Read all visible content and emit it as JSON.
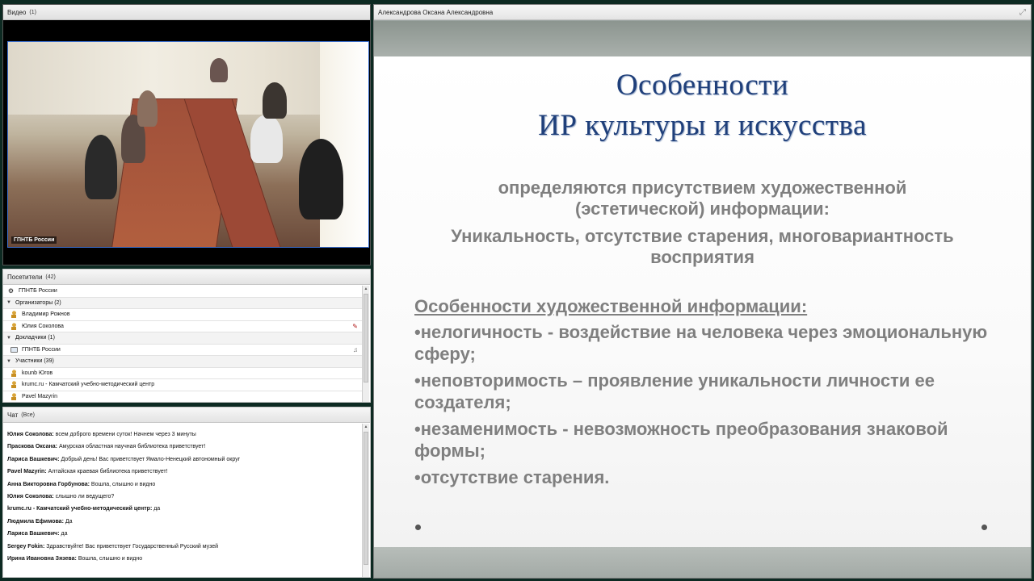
{
  "video_pod": {
    "title": "Видео",
    "count": "(1)",
    "camera_label": "ГПНТБ России"
  },
  "attendees_pod": {
    "title": "Посетители",
    "count": "(42)",
    "rows": [
      {
        "type": "room",
        "label": "ГПНТБ России"
      },
      {
        "type": "group",
        "label": "Организаторы (2)"
      },
      {
        "type": "member",
        "label": "Владимир Рожнов",
        "icon": "person-icon"
      },
      {
        "type": "member",
        "label": "Юлия Соколова",
        "icon": "person-icon",
        "status": "mic-off-icon"
      },
      {
        "type": "group",
        "label": "Докладчики (1)"
      },
      {
        "type": "member",
        "label": "ГПНТБ России",
        "icon": "monitor-icon",
        "status": "mic-on-icon"
      },
      {
        "type": "group",
        "label": "Участники (39)"
      },
      {
        "type": "member",
        "label": "kounb Югов",
        "icon": "person-icon"
      },
      {
        "type": "member",
        "label": "krumc.ru - Камчатский учебно-методический центр",
        "icon": "person-icon"
      },
      {
        "type": "member",
        "label": "Pavel Mazyrin",
        "icon": "person-icon"
      }
    ]
  },
  "chat_pod": {
    "title": "Чат",
    "scope": "(Все)",
    "messages": [
      {
        "author": "Юлия Соколова:",
        "text": " всем доброго времени суток! Начнем через 3 минуты"
      },
      {
        "author": "Праскова Оксана:",
        "text": " Амурская областная научная библиотека приветствует!"
      },
      {
        "author": "Лариса Вашкевич:",
        "text": " Добрый день! Вас приветствует Ямало-Ненецкий автономный округ"
      },
      {
        "author": "Pavel Mazyrin:",
        "text": " Алтайская краевая библиотека приветствует!"
      },
      {
        "author": "Анна Викторовна Горбунова:",
        "text": " Вошла, слышно и видно"
      },
      {
        "author": "Юлия Соколова:",
        "text": " слышно ли ведущего?"
      },
      {
        "author": "krumc.ru - Камчатский учебно-методический центр:",
        "text": " да"
      },
      {
        "author": "Людмила Ефимова:",
        "text": " Да"
      },
      {
        "author": "Лариса Вашкевич:",
        "text": " да"
      },
      {
        "author": "Sergey Fokin:",
        "text": " Здравствуйте! Вас приветствует Государственный Русский музей"
      },
      {
        "author": "Ирина Ивановна Зязева:",
        "text": " Вошла, слышно и видно"
      }
    ]
  },
  "share_pod": {
    "title": "Александрова Оксана Александровна",
    "slide": {
      "title_line1": "Особенности",
      "title_line2": "ИР культуры и искусства",
      "sub_line1": "определяются присутствием художественной",
      "sub_line2": "(эстетической) информации:",
      "sub_line3": "Уникальность, отсутствие старения, многовариантность",
      "sub_line4": "восприятия",
      "bullets_heading": "Особенности художественной информации:",
      "bullets": [
        "•нелогичность  - воздействие на человека через эмоциональную сферу;",
        "•неповторимость – проявление уникальности личности ее создателя;",
        "•незаменимость - невозможность преобразования знаковой формы;",
        "•отсутствие старения."
      ]
    }
  },
  "colors": {
    "background": "#0d2a22",
    "slide_title": "#1f3f7a",
    "slide_text": "#7f7f7f"
  }
}
